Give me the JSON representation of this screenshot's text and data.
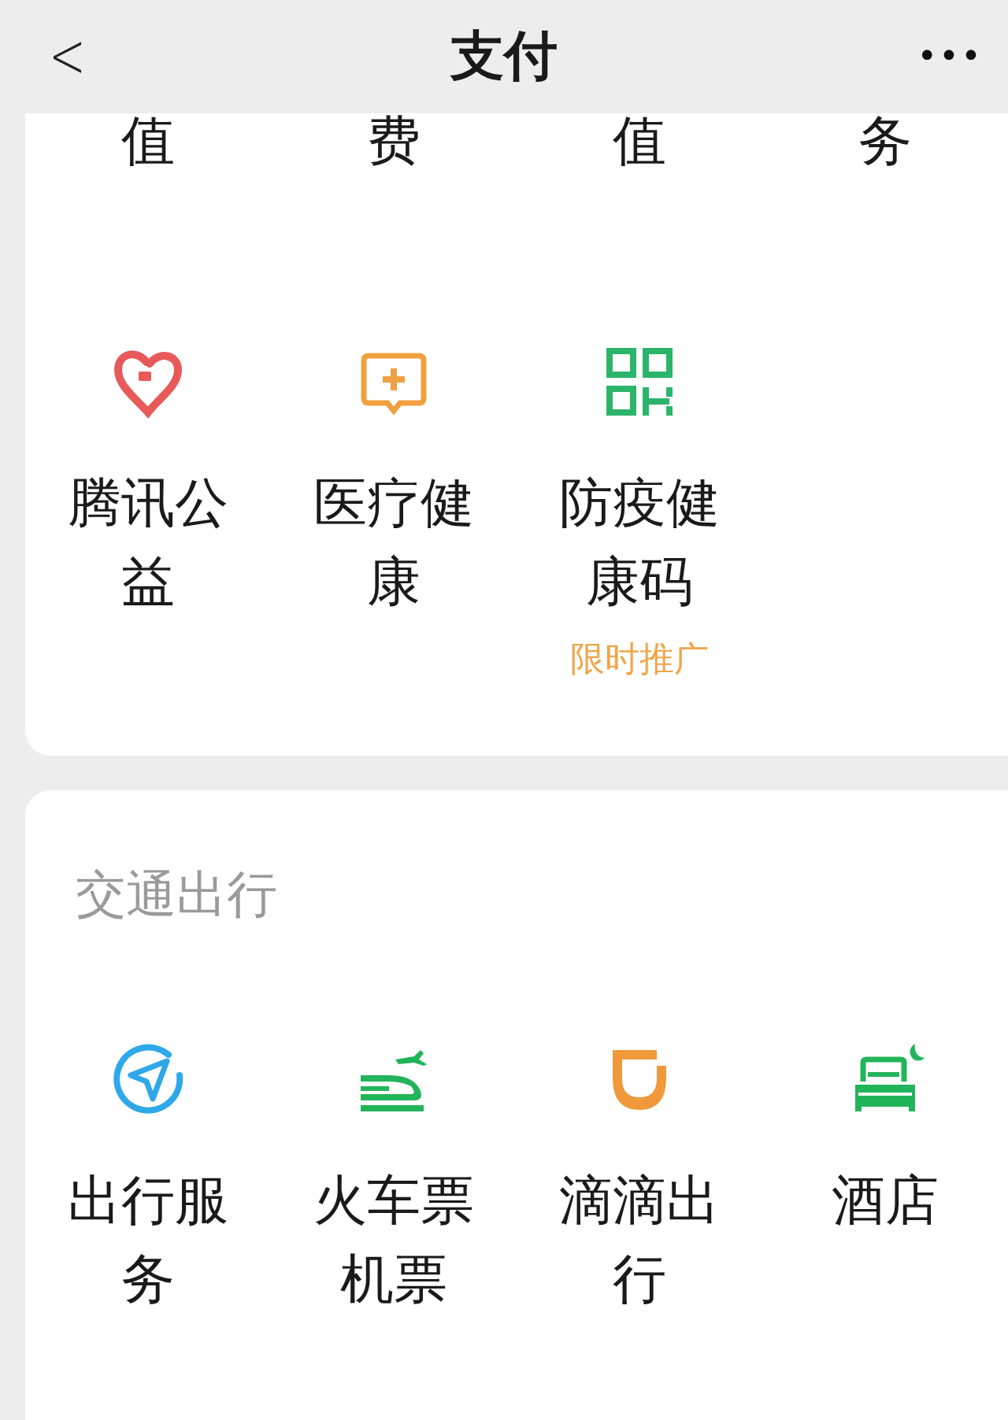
{
  "header": {
    "back": "<",
    "title": "支付",
    "more": "•••"
  },
  "services_card": {
    "cut_labels": [
      "值",
      "费",
      "值",
      "务"
    ],
    "items": [
      {
        "label": "腾讯公益"
      },
      {
        "label": "医疗健康"
      },
      {
        "label": "防疫健康码",
        "tag": "限时推广"
      }
    ]
  },
  "travel_card": {
    "title": "交通出行",
    "items": [
      {
        "label": "出行服务"
      },
      {
        "label": "火车票机票"
      },
      {
        "label": "滴滴出行"
      },
      {
        "label": "酒店"
      }
    ]
  }
}
